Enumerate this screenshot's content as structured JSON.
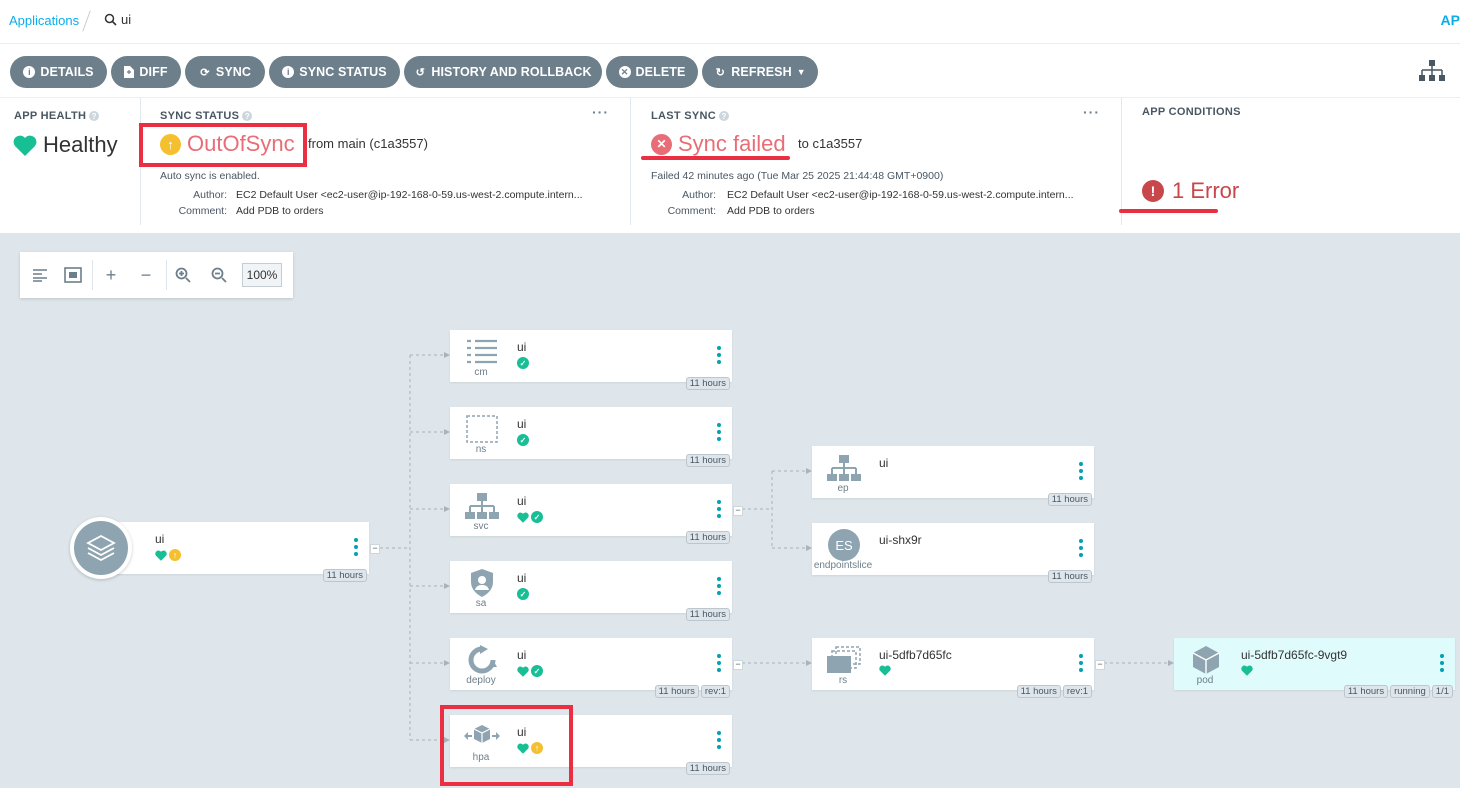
{
  "breadcrumb": {
    "applications": "Applications",
    "search": "ui",
    "right": "AP"
  },
  "toolbar": {
    "details": "DETAILS",
    "diff": "DIFF",
    "sync": "SYNC",
    "sync_status": "SYNC STATUS",
    "history": "HISTORY AND ROLLBACK",
    "delete": "DELETE",
    "refresh": "REFRESH"
  },
  "app_health": {
    "title": "APP HEALTH",
    "value": "Healthy",
    "color": "#18be94"
  },
  "sync_status": {
    "title": "SYNC STATUS",
    "value": "OutOfSync",
    "from": "from main (c1a3557)",
    "auto_sync": "Auto sync is enabled.",
    "author_label": "Author:",
    "author": "EC2 Default User <ec2-user@ip-192-168-0-59.us-west-2.compute.intern...",
    "comment_label": "Comment:",
    "comment": "Add PDB to orders",
    "color": "#f4c030"
  },
  "last_sync": {
    "title": "LAST SYNC",
    "value": "Sync failed",
    "to": "to c1a3557",
    "detail": "Failed 42 minutes ago (Tue Mar 25 2025 21:44:48 GMT+0900)",
    "author_label": "Author:",
    "author": "EC2 Default User <ec2-user@ip-192-168-0-59.us-west-2.compute.intern...",
    "comment_label": "Comment:",
    "comment": "Add PDB to orders",
    "color": "#e96d76"
  },
  "app_conditions": {
    "title": "APP CONDITIONS",
    "value": "1 Error",
    "color": "#c7474b"
  },
  "graph_tools": {
    "zoom": "100%"
  },
  "nodes": {
    "app": {
      "name": "ui",
      "age": "11 hours"
    },
    "cm": {
      "kind": "cm",
      "name": "ui",
      "age": "11 hours"
    },
    "ns": {
      "kind": "ns",
      "name": "ui",
      "age": "11 hours"
    },
    "svc": {
      "kind": "svc",
      "name": "ui",
      "age": "11 hours"
    },
    "sa": {
      "kind": "sa",
      "name": "ui",
      "age": "11 hours"
    },
    "deploy": {
      "kind": "deploy",
      "name": "ui",
      "age": "11 hours",
      "rev": "rev:1"
    },
    "hpa": {
      "kind": "hpa",
      "name": "ui",
      "age": "11 hours"
    },
    "ep": {
      "kind": "ep",
      "name": "ui",
      "age": "11 hours"
    },
    "eps": {
      "kind": "endpointslice",
      "name": "ui-shx9r",
      "age": "11 hours",
      "badge": "ES"
    },
    "rs": {
      "kind": "rs",
      "name": "ui-5dfb7d65fc",
      "age": "11 hours",
      "rev": "rev:1"
    },
    "pod": {
      "kind": "pod",
      "name": "ui-5dfb7d65fc-9vgt9",
      "age": "11 hours",
      "state": "running",
      "ready": "1/1"
    }
  }
}
